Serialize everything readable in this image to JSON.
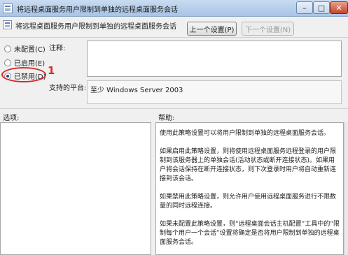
{
  "window": {
    "title": "将远程桌面服务用户限制到单独的远程桌面服务会话",
    "minimize_glyph": "–",
    "maximize_glyph": "□",
    "close_glyph": "✕"
  },
  "header": {
    "policy_name": "将远程桌面服务用户限制到单独的远程桌面服务会话",
    "prev_button": "上一个设置(P)",
    "next_button": "下一个设置(N)"
  },
  "state": {
    "options": [
      {
        "label": "未配置(C)",
        "selected": false
      },
      {
        "label": "已启用(E)",
        "selected": false
      },
      {
        "label": "已禁用(D)",
        "selected": true
      }
    ],
    "annotation_number": "1"
  },
  "fields": {
    "comment_label": "注释:",
    "comment_value": "",
    "platform_label": "支持的平台:",
    "platform_value": "至少 Windows Server 2003"
  },
  "panes": {
    "options_label": "选项:",
    "help_label": "帮助:",
    "help_paragraphs": [
      "使用此策略设置可以将用户限制到单独的远程桌面服务会话。",
      "如果启用此策略设置，则将使用远程桌面服务远程登录的用户限制到该服务器上的单独会话(活动状态或断开连接状态)。如果用户将会话保持在断开连接状态，则下次登录时用户将自动重新连接到该会话。",
      "如果禁用此策略设置，则允许用户使用远程桌面服务进行不限数量的同时远程连接。",
      "如果未配置此策略设置，则“远程桌面会话主机配置”工具中的“限制每个用户一个会话”设置将确定是否将用户限制到单独的远程桌面服务会话。"
    ]
  }
}
